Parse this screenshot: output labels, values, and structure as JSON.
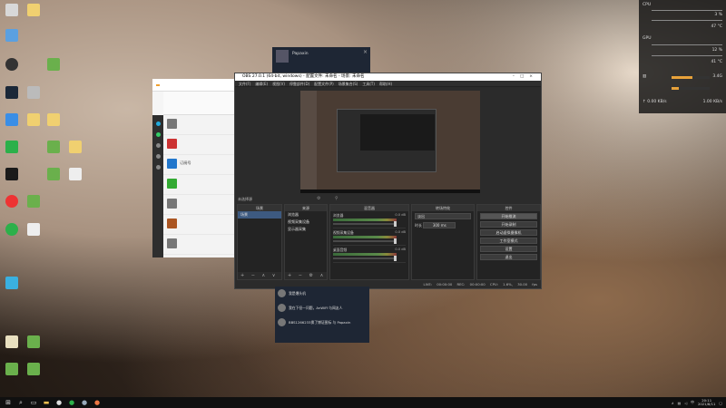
{
  "desktop": {
    "icons": [
      {
        "label": "",
        "x": 0
      },
      {
        "label": "",
        "x": 0
      },
      {
        "label": "",
        "x": 0
      },
      {
        "label": "",
        "x": 0
      },
      {
        "label": "",
        "x": 0
      }
    ]
  },
  "widget": {
    "cpu_label": "CPU",
    "cpu_temp": "",
    "cpu_pct": "3 %",
    "cpu_deg": "47 °C",
    "gpu_label": "GPU",
    "gpu_pct": "12 %",
    "gpu_deg": "41 °C",
    "mem_val": "3.4G",
    "disk_val": "",
    "net_up": "0.00 KB/s",
    "net_down": "1.00 KB/s",
    "accent": "#e8a23a"
  },
  "steam": {
    "name": "Papaxin",
    "status": "",
    "accent": "#1e2634"
  },
  "chat": {
    "menu": [
      "",
      "",
      "",
      "",
      ""
    ],
    "items": [
      {
        "title": "",
        "sub": ""
      },
      {
        "title": "",
        "sub": ""
      },
      {
        "title": "订阅号",
        "sub": ""
      },
      {
        "title": "",
        "sub": ""
      },
      {
        "title": "",
        "sub": ""
      },
      {
        "title": "",
        "sub": ""
      },
      {
        "title": "",
        "sub": ""
      }
    ]
  },
  "obs": {
    "title": "OBS 27.0.1 (64-bit, windows) - 配置文件: 未命名 - 场景: 未命名",
    "menu": [
      "文件(F)",
      "编辑(E)",
      "视图(V)",
      "停靠部件(D)",
      "配置文件(P)",
      "场景集合(S)",
      "工具(T)",
      "帮助(H)"
    ],
    "scene_label": "未选择源",
    "docks": {
      "scenes": {
        "header": "场景",
        "items": [
          "场景"
        ]
      },
      "sources": {
        "header": "来源",
        "items": [
          "浏览器",
          "视频采集设备",
          "显示器采集"
        ]
      },
      "mixer": {
        "header": "混音器",
        "channels": [
          {
            "name": "浏览器",
            "db": "0.0 dB"
          },
          {
            "name": "视频采集设备",
            "db": "0.0 dB"
          },
          {
            "name": "桌面音频",
            "db": "0.0 dB"
          }
        ]
      },
      "transitions": {
        "header": "转场特效",
        "type": "淡出",
        "duration_label": "时长",
        "duration": "300 ms"
      },
      "controls": {
        "header": "控件",
        "buttons": [
          "开始推流",
          "开始录制",
          "启动虚拟摄像机",
          "工作室模式",
          "设置",
          "退出"
        ]
      }
    },
    "status": "LIVE: 00:00:00   REC: 00:00:00   CPU: 1.6%, 30.00 fps"
  },
  "notify": {
    "rows": [
      "我是爆头机",
      "我在下但一问题，AnWiFi‘与网友人",
      "BBS1266233换了博证图标 与 Papaxin"
    ]
  },
  "taskbar": {
    "time": "20:11",
    "date": "2021/8/11",
    "icons": [
      "windows-logo",
      "search",
      "task-view",
      "file-explorer",
      "obs",
      "wechat",
      "steam",
      "chrome"
    ]
  }
}
